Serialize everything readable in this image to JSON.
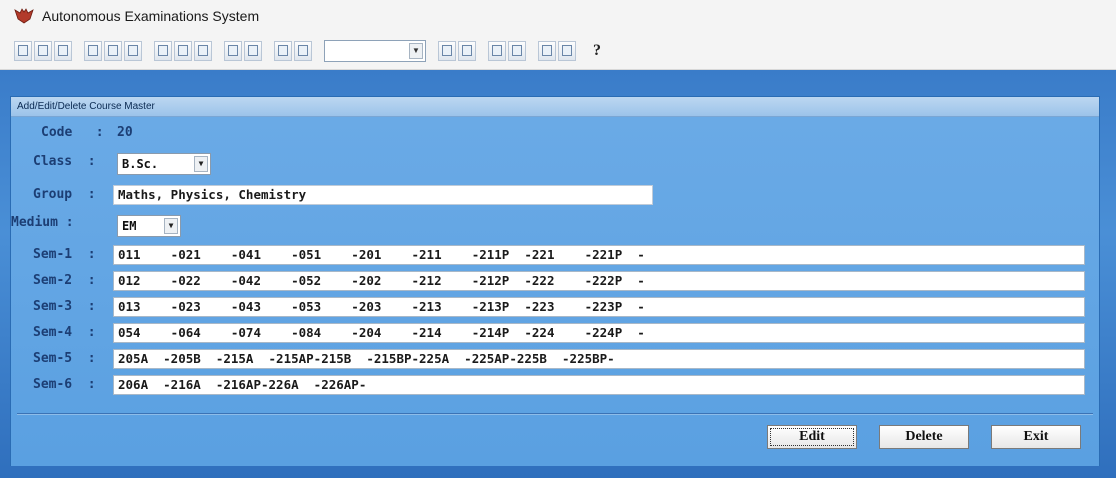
{
  "window": {
    "title": "Autonomous Examinations System",
    "icon": "bat-logo-icon"
  },
  "toolbar": {
    "combo_value": "",
    "help_label": "?"
  },
  "dialog": {
    "title": "Add/Edit/Delete Course Master",
    "code": {
      "label": "Code   :",
      "value": "20"
    },
    "class": {
      "label": "Class  :",
      "value": "B.Sc."
    },
    "group": {
      "label": "Group  :",
      "value": "Maths, Physics, Chemistry"
    },
    "medium": {
      "label": "Medium :",
      "value": "EM"
    },
    "semesters": [
      {
        "label": "Sem-1  :",
        "value": "011    -021    -041    -051    -201    -211    -211P  -221    -221P  -"
      },
      {
        "label": "Sem-2  :",
        "value": "012    -022    -042    -052    -202    -212    -212P  -222    -222P  -"
      },
      {
        "label": "Sem-3  :",
        "value": "013    -023    -043    -053    -203    -213    -213P  -223    -223P  -"
      },
      {
        "label": "Sem-4  :",
        "value": "054    -064    -074    -084    -204    -214    -214P  -224    -224P  -"
      },
      {
        "label": "Sem-5  :",
        "value": "205A  -205B  -215A  -215AP-215B  -215BP-225A  -225AP-225B  -225BP-"
      },
      {
        "label": "Sem-6  :",
        "value": "206A  -216A  -216AP-226A  -226AP-"
      }
    ],
    "buttons": {
      "edit": "Edit",
      "delete": "Delete",
      "exit": "Exit"
    }
  }
}
